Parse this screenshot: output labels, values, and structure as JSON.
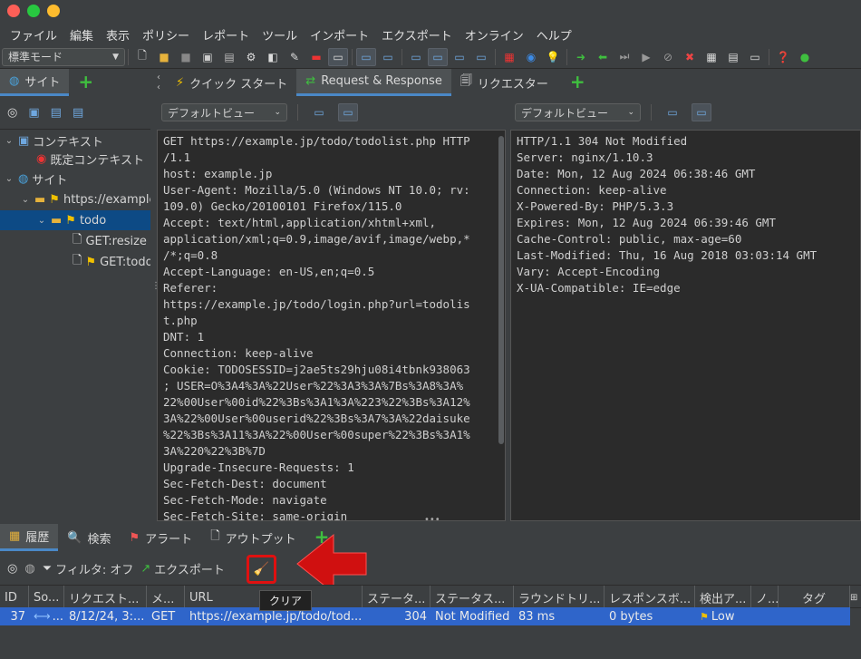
{
  "menu": [
    "ファイル",
    "編集",
    "表示",
    "ポリシー",
    "レポート",
    "ツール",
    "インポート",
    "エクスポート",
    "オンライン",
    "ヘルプ"
  ],
  "toolbar": {
    "mode": "標準モード"
  },
  "left_panel": {
    "tab_sites": "サイト",
    "tree": {
      "contexts": "コンテキスト",
      "default_context": "既定コンテキスト",
      "sites": "サイト",
      "host": "https://example.jp",
      "folder": "todo",
      "leaf1": "GET:resize",
      "leaf2": "GET:todo"
    }
  },
  "main_tabs": {
    "quick_start": "クイック スタート",
    "req_resp": "Request & Response",
    "requester": "リクエスター"
  },
  "view_select": {
    "left": "デフォルトビュー",
    "right": "デフォルトビュー"
  },
  "request_text": "GET https://example.jp/todo/todolist.php HTTP\n/1.1\nhost: example.jp\nUser-Agent: Mozilla/5.0 (Windows NT 10.0; rv:\n109.0) Gecko/20100101 Firefox/115.0\nAccept: text/html,application/xhtml+xml,\napplication/xml;q=0.9,image/avif,image/webp,*\n/*;q=0.8\nAccept-Language: en-US,en;q=0.5\nReferer:\nhttps://example.jp/todo/login.php?url=todolis\nt.php\nDNT: 1\nConnection: keep-alive\nCookie: TODOSESSID=j2ae5ts29hju08i4tbnk938063\n; USER=O%3A4%3A%22User%22%3A3%3A%7Bs%3A8%3A%\n22%00User%00id%22%3Bs%3A1%3A%223%22%3Bs%3A12%\n3A%22%00User%00userid%22%3Bs%3A7%3A%22daisuke\n%22%3Bs%3A11%3A%22%00User%00super%22%3Bs%3A1%\n3A%220%22%3B%7D\nUpgrade-Insecure-Requests: 1\nSec-Fetch-Dest: document\nSec-Fetch-Mode: navigate\nSec-Fetch-Site: same-origin",
  "response_text": "HTTP/1.1 304 Not Modified\nServer: nginx/1.10.3\nDate: Mon, 12 Aug 2024 06:38:46 GMT\nConnection: keep-alive\nX-Powered-By: PHP/5.3.3\nExpires: Mon, 12 Aug 2024 06:39:46 GMT\nCache-Control: public, max-age=60\nLast-Modified: Thu, 16 Aug 2018 03:03:14 GMT\nVary: Accept-Encoding\nX-UA-Compatible: IE=edge",
  "bottom_tabs": {
    "history": "履歴",
    "search": "検索",
    "alerts": "アラート",
    "output": "アウトプット"
  },
  "history_toolbar": {
    "filter": "フィルタ: オフ",
    "export": "エクスポート",
    "tooltip": "クリア"
  },
  "table": {
    "headers": [
      "ID",
      "So...",
      "リクエスト...",
      "メ...",
      "URL",
      "ステータ...",
      "ステータス...",
      "ラウンドトリ...",
      "レスポンスボ...",
      "検出ア...",
      "ノ...",
      "タグ"
    ],
    "row": {
      "id": "37",
      "source": "...",
      "time": "8/12/24, 3:...",
      "method": "GET",
      "url": "https://example.jp/todo/tod...",
      "code": "304",
      "reason": "Not Modified",
      "rtt": "83 ms",
      "size": "0 bytes",
      "risk": "Low"
    }
  },
  "colors": {
    "accent": "#4a88c7",
    "highlight_box": "#e01010",
    "arrow": "#d01010"
  }
}
